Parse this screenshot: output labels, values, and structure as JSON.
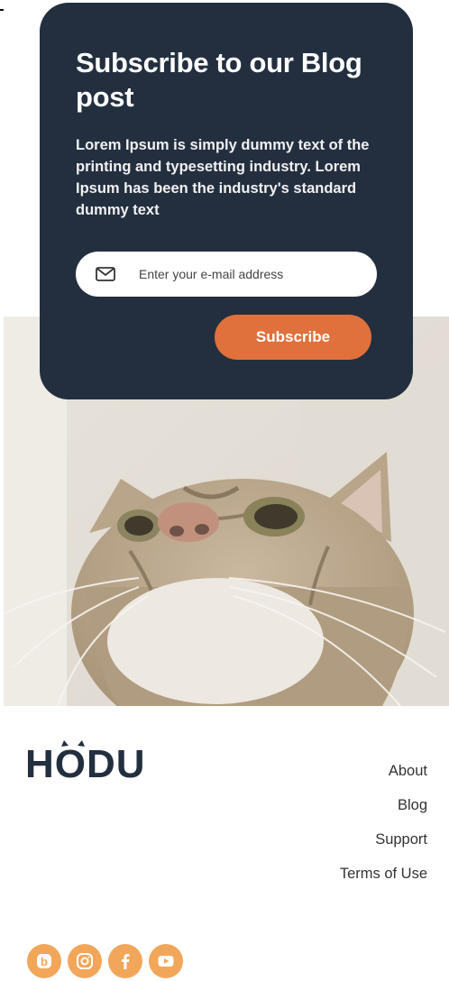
{
  "subscribe": {
    "title": "Subscribe to our Blog post",
    "description": "Lorem Ipsum is simply dummy text of the printing and typesetting industry. Lorem Ipsum has been the industry's standard dummy text",
    "email_placeholder": "Enter your e-mail address",
    "button_label": "Subscribe"
  },
  "hero": {
    "icon": "cat-photo"
  },
  "footer": {
    "logo_text": "HODU",
    "nav": [
      "About",
      "Blog",
      "Support",
      "Terms of Use"
    ],
    "social": [
      "blogger-icon",
      "instagram-icon",
      "facebook-icon",
      "youtube-icon"
    ]
  },
  "colors": {
    "card_bg": "#232f3f",
    "accent": "#e0713c",
    "social_bg": "#f2a65a",
    "logo": "#232f3f"
  }
}
